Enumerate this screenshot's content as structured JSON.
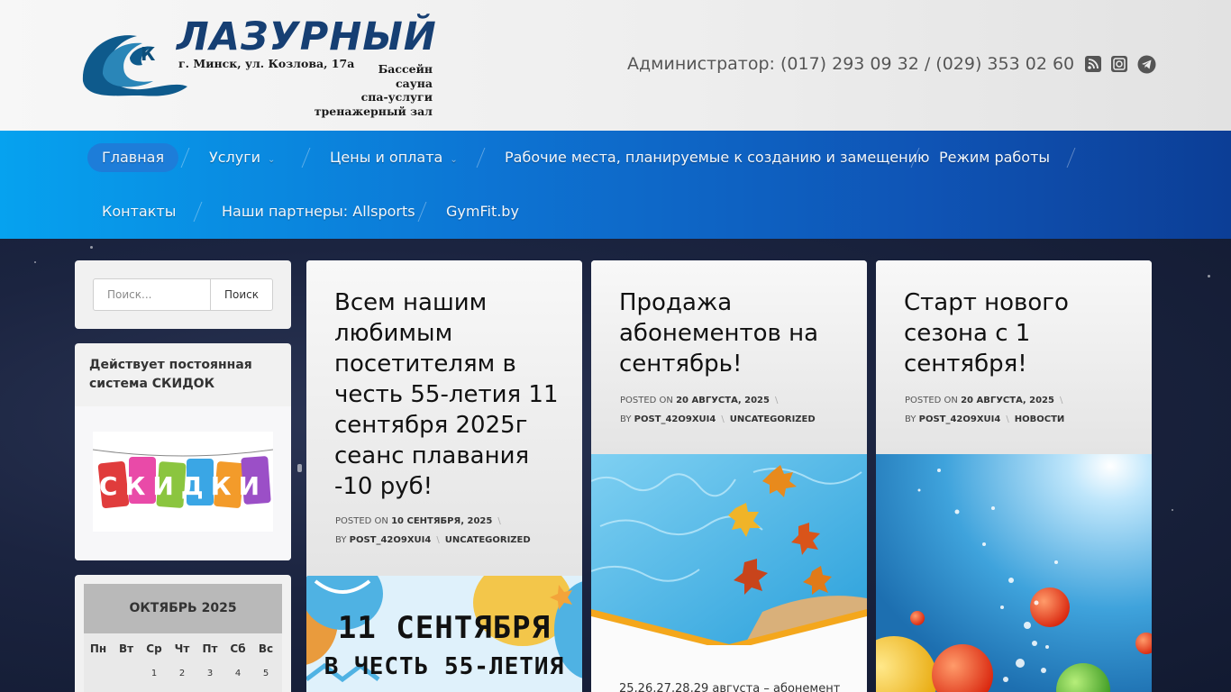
{
  "header": {
    "logo_title": "ЛАЗУРНЫЙ",
    "logo_k": "К",
    "logo_address": "г. Минск, ул. Козлова, 17а",
    "logo_services": [
      "Бассейн",
      "сауна",
      "спа-услуги",
      "тренажерный зал"
    ],
    "admin_phone": "Администратор: (017) 293 09 32 / (029) 353 02 60",
    "social_icons": [
      "rss-icon",
      "instagram-icon",
      "telegram-icon"
    ]
  },
  "nav": {
    "items": [
      {
        "label": "Главная",
        "active": true
      },
      {
        "label": "Услуги",
        "dropdown": true
      },
      {
        "label": "Цены и оплата",
        "dropdown": true
      },
      {
        "label": "Рабочие места, планируемые к созданию и замещению"
      },
      {
        "label": "Режим работы"
      },
      {
        "label": "Контакты"
      },
      {
        "label": "Наши партнеры: Allsports"
      },
      {
        "label": "GymFit.by"
      }
    ]
  },
  "sidebar": {
    "search": {
      "placeholder": "Поиск...",
      "button": "Поиск"
    },
    "discount": {
      "title": "Действует постоянная система СКИДОК",
      "banner_text": "СКИДКИ"
    },
    "calendar": {
      "month": "ОКТЯБРЬ 2025",
      "weekdays": [
        "Пн",
        "Вт",
        "Ср",
        "Чт",
        "Пт",
        "Сб",
        "Вс"
      ],
      "first_row": [
        "",
        "",
        "1",
        "2",
        "3",
        "4",
        "5"
      ]
    }
  },
  "posts": [
    {
      "title": "Всем нашим любимым посетителям в честь 55-летия 11 сентября 2025г сеанс плавания -10 руб!",
      "posted_on_label": "POSTED ON",
      "date": "10 СЕНТЯБРЯ, 2025",
      "by_label": "BY",
      "author": "POST_42O9XUI4",
      "category": "UNCATEGORIZED",
      "image_line1": "11 СЕНТЯБРЯ",
      "image_line2": "В ЧЕСТЬ 55-ЛЕТИЯ"
    },
    {
      "title": "Продажа абонементов на сентябрь!",
      "posted_on_label": "POSTED ON",
      "date": "20 АВГУСТА, 2025",
      "by_label": "BY",
      "author": "POST_42O9XUI4",
      "category": "UNCATEGORIZED",
      "excerpt": "25,26,27,28,29 августа – абонемент"
    },
    {
      "title": "Старт нового сезона с 1 сентября!",
      "posted_on_label": "POSTED ON",
      "date": "20 АВГУСТА, 2025",
      "by_label": "BY",
      "author": "POST_42O9XUI4",
      "category": "НОВОСТИ"
    }
  ],
  "colors": {
    "nav_start": "#06a2ef",
    "nav_end": "#0c3e96",
    "logo_blue": "#163f73",
    "body_bg": "#1a2340"
  }
}
